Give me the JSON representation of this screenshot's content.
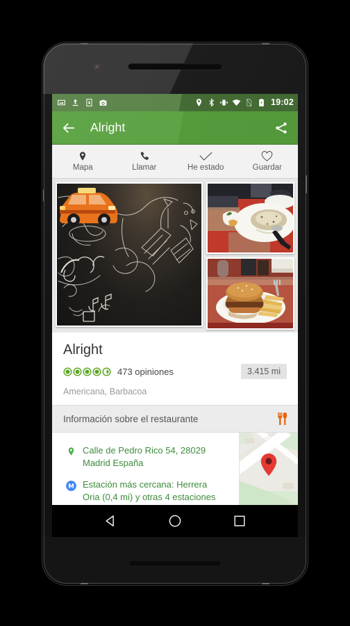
{
  "status_bar": {
    "icons_left": [
      "image-icon",
      "upload-icon",
      "download-icon",
      "screenshot-icon"
    ],
    "icons_right": [
      "location-icon",
      "bluetooth-icon",
      "vibrate-icon",
      "wifi-icon",
      "sim-off-icon",
      "battery-charging-icon"
    ],
    "clock": "19:02"
  },
  "toolbar": {
    "back_icon": "back-arrow-icon",
    "title": "Alright",
    "share_icon": "share-icon",
    "color": "#57a03e"
  },
  "action_tabs": [
    {
      "icon": "map-pin-icon",
      "label": "Mapa"
    },
    {
      "icon": "phone-icon",
      "label": "Llamar"
    },
    {
      "icon": "check-icon",
      "label": "He estado"
    },
    {
      "icon": "heart-icon",
      "label": "Guardar"
    }
  ],
  "gallery": {
    "photos": [
      {
        "name": "restaurant-mural-photo",
        "alt": "Mural chalk drawing with orange taxi"
      },
      {
        "name": "rice-dish-photo",
        "alt": "Plate of risotto on red table"
      },
      {
        "name": "burger-fries-photo",
        "alt": "Burger with french fries"
      }
    ]
  },
  "info": {
    "name": "Alright",
    "rating_value": 4.5,
    "rating_max": 5,
    "rating_color": "#5aa31f",
    "review_count": "473 opiniones",
    "distance": "3.415 mi",
    "categories": "Americana, Barbacoa"
  },
  "section": {
    "title": "Información sobre el restaurante",
    "icon": "cutlery-icon",
    "icon_color": "#e8620c"
  },
  "details": [
    {
      "icon": "map-pin-icon",
      "name": "address-row",
      "line1": "Calle de Pedro Rico 54, 28029",
      "line2": "Madrid España"
    },
    {
      "icon": "metro-icon",
      "name": "transit-row",
      "line1": "Estación más cercana: Herrera",
      "line2": "Oria (0,4 mi) y otras 4 estaciones"
    }
  ],
  "map_thumbnail": {
    "name": "map-thumbnail",
    "marker": "map-marker-icon",
    "marker_color": "#e53935"
  },
  "nav_bar": {
    "back": "nav-back-icon",
    "home": "nav-home-icon",
    "recents": "nav-recents-icon"
  }
}
